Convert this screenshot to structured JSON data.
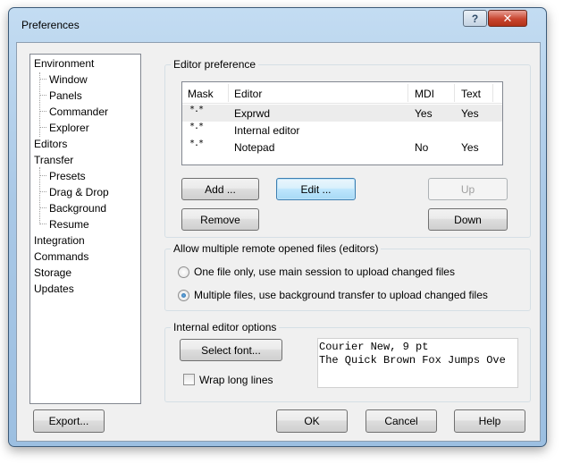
{
  "window": {
    "title": "Preferences",
    "help_glyph": "?",
    "close_glyph": "✕"
  },
  "tree": {
    "items": [
      {
        "label": "Environment",
        "level": 0
      },
      {
        "label": "Window",
        "level": 1
      },
      {
        "label": "Panels",
        "level": 1
      },
      {
        "label": "Commander",
        "level": 1
      },
      {
        "label": "Explorer",
        "level": 1
      },
      {
        "label": "Editors",
        "level": 0,
        "selected": true
      },
      {
        "label": "Transfer",
        "level": 0
      },
      {
        "label": "Presets",
        "level": 1
      },
      {
        "label": "Drag & Drop",
        "level": 1
      },
      {
        "label": "Background",
        "level": 1
      },
      {
        "label": "Resume",
        "level": 1
      },
      {
        "label": "Integration",
        "level": 0
      },
      {
        "label": "Commands",
        "level": 0
      },
      {
        "label": "Storage",
        "level": 0
      },
      {
        "label": "Updates",
        "level": 0
      }
    ]
  },
  "editor_pref": {
    "title": "Editor preference",
    "columns": [
      "Mask",
      "Editor",
      "MDI",
      "Text"
    ],
    "rows": [
      {
        "mask": "*.*",
        "editor": "Exprwd",
        "mdi": "Yes",
        "text": "Yes",
        "selected": true
      },
      {
        "mask": "*.*",
        "editor": "Internal editor",
        "mdi": "",
        "text": ""
      },
      {
        "mask": "*.*",
        "editor": "Notepad",
        "mdi": "No",
        "text": "Yes"
      }
    ],
    "add_label": "Add ...",
    "edit_label": "Edit ...",
    "remove_label": "Remove",
    "up_label": "Up",
    "down_label": "Down"
  },
  "multi": {
    "title": "Allow multiple remote opened files (editors)",
    "option1": "One file only, use main session to upload changed files",
    "option2": "Multiple files, use background transfer to upload changed files",
    "selected": 2
  },
  "internal": {
    "title": "Internal editor options",
    "select_font_label": "Select font...",
    "wrap_label": "Wrap long lines",
    "wrap_checked": false,
    "preview_line1": "Courier New, 9 pt",
    "preview_line2": "The Quick Brown Fox Jumps Ove"
  },
  "footer": {
    "export_label": "Export...",
    "ok_label": "OK",
    "cancel_label": "Cancel",
    "help_label": "Help"
  }
}
